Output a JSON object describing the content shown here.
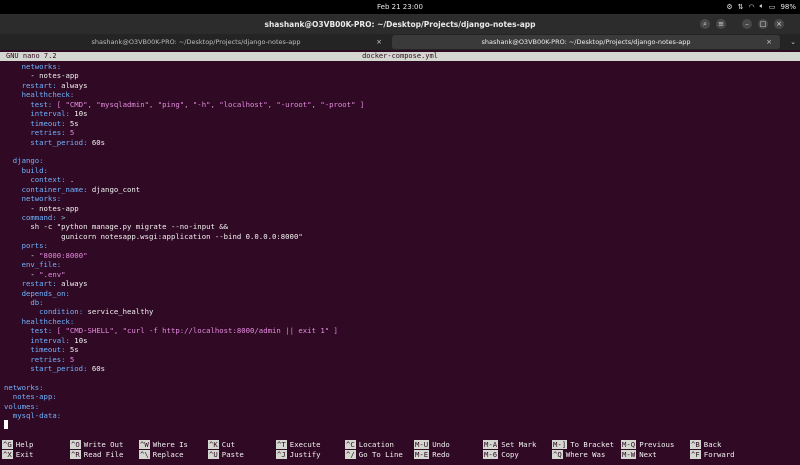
{
  "topbar": {
    "datetime": "Feb 21  23:00",
    "battery": "98%"
  },
  "window": {
    "title": "shashank@O3VB00K-PRO: ~/Desktop/Projects/django-notes-app"
  },
  "tabs": [
    {
      "label": "shashank@O3VB00K-PRO: ~/Desktop/Projects/django-notes-app",
      "active": false
    },
    {
      "label": "shashank@O3VB00K-PRO: ~/Desktop/Projects/django-notes-app",
      "active": true
    }
  ],
  "nano": {
    "version": "GNU nano 7.2",
    "filename": "docker-compose.yml"
  },
  "code_lines": [
    [
      {
        "t": "    "
      },
      {
        "t": "networks:",
        "c": "k"
      }
    ],
    [
      {
        "t": "      - notes-app"
      }
    ],
    [
      {
        "t": "    "
      },
      {
        "t": "restart:",
        "c": "k"
      },
      {
        "t": " always"
      }
    ],
    [
      {
        "t": "    "
      },
      {
        "t": "healthcheck:",
        "c": "k"
      }
    ],
    [
      {
        "t": "      "
      },
      {
        "t": "test:",
        "c": "k"
      },
      {
        "t": " [ ",
        "c": "s"
      },
      {
        "t": "\"CMD\", \"mysqladmin\", \"ping\", \"-h\", \"localhost\", \"-uroot\", \"-proot\"",
        "c": "s"
      },
      {
        "t": " ]",
        "c": "s"
      }
    ],
    [
      {
        "t": "      "
      },
      {
        "t": "interval:",
        "c": "k"
      },
      {
        "t": " 10s"
      }
    ],
    [
      {
        "t": "      "
      },
      {
        "t": "timeout:",
        "c": "k"
      },
      {
        "t": " 5s"
      }
    ],
    [
      {
        "t": "      "
      },
      {
        "t": "retries:",
        "c": "k"
      },
      {
        "t": " 5",
        "c": "s"
      }
    ],
    [
      {
        "t": "      "
      },
      {
        "t": "start_period:",
        "c": "k"
      },
      {
        "t": " 60s"
      }
    ],
    [
      {
        "t": ""
      }
    ],
    [
      {
        "t": "  "
      },
      {
        "t": "django:",
        "c": "k"
      }
    ],
    [
      {
        "t": "    "
      },
      {
        "t": "build:",
        "c": "k"
      }
    ],
    [
      {
        "t": "      "
      },
      {
        "t": "context:",
        "c": "k"
      },
      {
        "t": " ."
      }
    ],
    [
      {
        "t": "    "
      },
      {
        "t": "container_name:",
        "c": "k"
      },
      {
        "t": " django_cont"
      }
    ],
    [
      {
        "t": "    "
      },
      {
        "t": "networks:",
        "c": "k"
      }
    ],
    [
      {
        "t": "      - notes-app"
      }
    ],
    [
      {
        "t": "    "
      },
      {
        "t": "command:",
        "c": "k"
      },
      {
        "t": " >",
        "c": "d"
      }
    ],
    [
      {
        "t": "      sh -c \"python manage.py migrate --no-input &&"
      }
    ],
    [
      {
        "t": "             gunicorn notesapp.wsgi:application --bind 0.0.0.0:8000\""
      }
    ],
    [
      {
        "t": "    "
      },
      {
        "t": "ports:",
        "c": "k"
      }
    ],
    [
      {
        "t": "      - "
      },
      {
        "t": "\"8000:8000\"",
        "c": "s"
      }
    ],
    [
      {
        "t": "    "
      },
      {
        "t": "env_file:",
        "c": "k"
      }
    ],
    [
      {
        "t": "      - "
      },
      {
        "t": "\".env\"",
        "c": "s"
      }
    ],
    [
      {
        "t": "    "
      },
      {
        "t": "restart:",
        "c": "k"
      },
      {
        "t": " always"
      }
    ],
    [
      {
        "t": "    "
      },
      {
        "t": "depends_on:",
        "c": "k"
      }
    ],
    [
      {
        "t": "      "
      },
      {
        "t": "db:",
        "c": "k"
      }
    ],
    [
      {
        "t": "        "
      },
      {
        "t": "condition:",
        "c": "k"
      },
      {
        "t": " service_healthy"
      }
    ],
    [
      {
        "t": "    "
      },
      {
        "t": "healthcheck:",
        "c": "k"
      }
    ],
    [
      {
        "t": "      "
      },
      {
        "t": "test:",
        "c": "k"
      },
      {
        "t": " [ ",
        "c": "s"
      },
      {
        "t": "\"CMD-SHELL\", \"curl -f http://localhost:8000/admin || exit 1\"",
        "c": "s"
      },
      {
        "t": " ]",
        "c": "s"
      }
    ],
    [
      {
        "t": "      "
      },
      {
        "t": "interval:",
        "c": "k"
      },
      {
        "t": " 10s"
      }
    ],
    [
      {
        "t": "      "
      },
      {
        "t": "timeout:",
        "c": "k"
      },
      {
        "t": " 5s"
      }
    ],
    [
      {
        "t": "      "
      },
      {
        "t": "retries:",
        "c": "k"
      },
      {
        "t": " 5",
        "c": "s"
      }
    ],
    [
      {
        "t": "      "
      },
      {
        "t": "start_period:",
        "c": "k"
      },
      {
        "t": " 60s"
      }
    ],
    [
      {
        "t": ""
      }
    ],
    [
      {
        "t": "networks:",
        "c": "k"
      }
    ],
    [
      {
        "t": "  "
      },
      {
        "t": "notes-app:",
        "c": "k"
      }
    ],
    [
      {
        "t": "volumes:",
        "c": "k"
      }
    ],
    [
      {
        "t": "  "
      },
      {
        "t": "mysql-data:",
        "c": "k"
      }
    ]
  ],
  "shortcuts": [
    [
      {
        "key": "^G",
        "label": "Help"
      },
      {
        "key": "^X",
        "label": "Exit"
      }
    ],
    [
      {
        "key": "^O",
        "label": "Write Out"
      },
      {
        "key": "^R",
        "label": "Read File"
      }
    ],
    [
      {
        "key": "^W",
        "label": "Where Is"
      },
      {
        "key": "^\\",
        "label": "Replace"
      }
    ],
    [
      {
        "key": "^K",
        "label": "Cut"
      },
      {
        "key": "^U",
        "label": "Paste"
      }
    ],
    [
      {
        "key": "^T",
        "label": "Execute"
      },
      {
        "key": "^J",
        "label": "Justify"
      }
    ],
    [
      {
        "key": "^C",
        "label": "Location"
      },
      {
        "key": "^/",
        "label": "Go To Line"
      }
    ],
    [
      {
        "key": "M-U",
        "label": "Undo"
      },
      {
        "key": "M-E",
        "label": "Redo"
      }
    ],
    [
      {
        "key": "M-A",
        "label": "Set Mark"
      },
      {
        "key": "M-6",
        "label": "Copy"
      }
    ],
    [
      {
        "key": "M-]",
        "label": "To Bracket"
      },
      {
        "key": "^Q",
        "label": "Where Was"
      }
    ],
    [
      {
        "key": "M-Q",
        "label": "Previous"
      },
      {
        "key": "M-W",
        "label": "Next"
      }
    ],
    [
      {
        "key": "^B",
        "label": "Back"
      },
      {
        "key": "^F",
        "label": "Forward"
      }
    ]
  ],
  "colors": {
    "terminal_bg": "#300a24",
    "key_color": "#6fb3ff",
    "string_color": "#e58be0"
  }
}
